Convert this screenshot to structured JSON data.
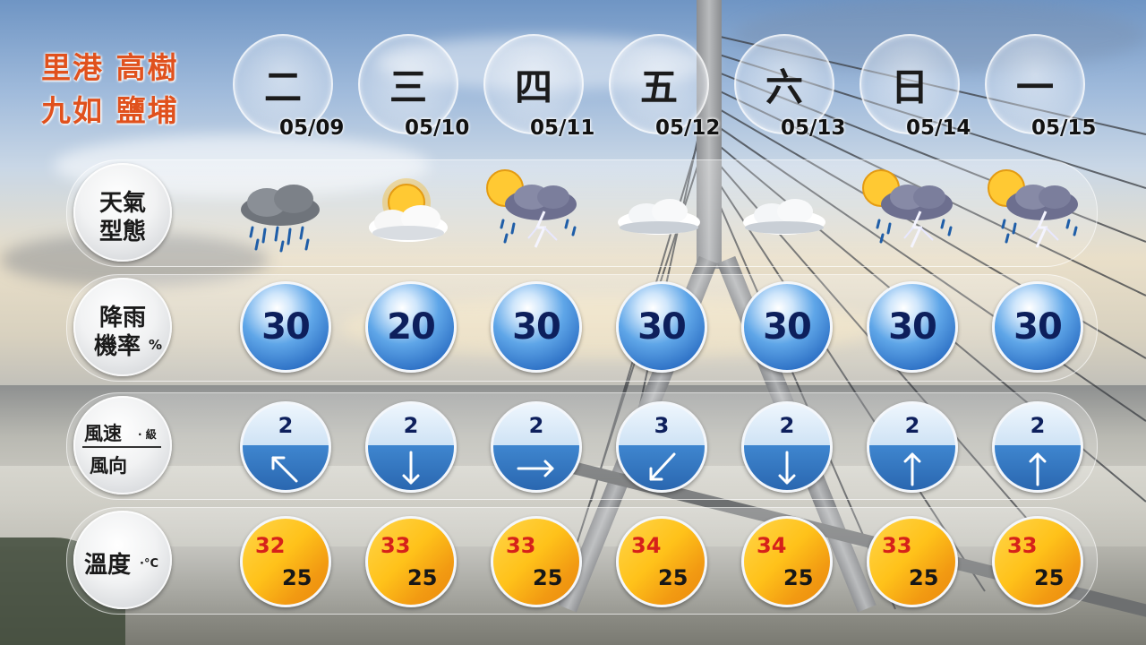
{
  "location": {
    "line1": "里港 高樹",
    "line2": "九如 鹽埔"
  },
  "row_labels": {
    "weather": [
      "天氣",
      "型態"
    ],
    "rain": [
      "降雨",
      "機率",
      "%"
    ],
    "wind": [
      "風速",
      "級",
      "風向"
    ],
    "temp": [
      "溫度",
      "°C"
    ]
  },
  "days": [
    {
      "name": "二",
      "date": "05/09",
      "weather_icon": "cloud-rain-icon",
      "rain": "30",
      "wind_level": "2",
      "wind_dir": "northwest-arrow-icon",
      "high": "32",
      "low": "25"
    },
    {
      "name": "三",
      "date": "05/10",
      "weather_icon": "sun-cloud-icon",
      "rain": "20",
      "wind_level": "2",
      "wind_dir": "down-arrow-icon",
      "high": "33",
      "low": "25"
    },
    {
      "name": "四",
      "date": "05/11",
      "weather_icon": "sun-thunderstorm-icon",
      "rain": "30",
      "wind_level": "2",
      "wind_dir": "right-arrow-icon",
      "high": "33",
      "low": "25"
    },
    {
      "name": "五",
      "date": "05/12",
      "weather_icon": "cloud-icon",
      "rain": "30",
      "wind_level": "3",
      "wind_dir": "southwest-arrow-icon",
      "high": "34",
      "low": "25"
    },
    {
      "name": "六",
      "date": "05/13",
      "weather_icon": "cloud-icon",
      "rain": "30",
      "wind_level": "2",
      "wind_dir": "down-arrow-icon",
      "high": "34",
      "low": "25"
    },
    {
      "name": "日",
      "date": "05/14",
      "weather_icon": "sun-thunderstorm-icon",
      "rain": "30",
      "wind_level": "2",
      "wind_dir": "up-arrow-icon",
      "high": "33",
      "low": "25"
    },
    {
      "name": "一",
      "date": "05/15",
      "weather_icon": "sun-thunderstorm-icon",
      "rain": "30",
      "wind_level": "2",
      "wind_dir": "up-arrow-icon",
      "high": "33",
      "low": "25"
    }
  ],
  "colors": {
    "location_text": "#e0511d",
    "rain_ball": "#2c6fc4",
    "temp_high": "#d6211a",
    "temp_ball": "#ffc21a"
  }
}
